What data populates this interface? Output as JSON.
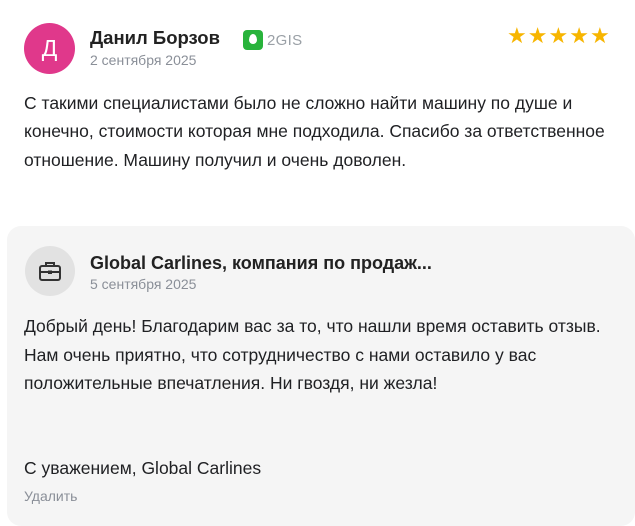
{
  "review": {
    "avatar_letter": "Д",
    "author": "Данил Борзов",
    "source": "2GIS",
    "date": "2 сентября 2025",
    "rating": 5,
    "stars": [
      "★",
      "★",
      "★",
      "★",
      "★"
    ],
    "text": "С такими специалистами было не сложно найти машину по душе и конечно, стоимости которая мне подходила. Спасибо за ответственное отношение. Машину получил и очень доволен."
  },
  "reply": {
    "avatar_icon": "briefcase-icon",
    "company": "Global Carlines, компания по продаж...",
    "date": "5 сентября 2025",
    "text": "Добрый день! Благодарим вас за то, что нашли время оставить отзыв. Нам очень приятно, что сотрудничество с нами оставило у вас положительные впечатления. Ни гвоздя, ни жезла!",
    "signature": "С уважением, Global Carlines",
    "delete_label": "Удалить"
  },
  "colors": {
    "avatar": "#e0388b",
    "star": "#f7b500",
    "source_logo": "#28b33b",
    "reply_bg": "#f5f5f5"
  }
}
